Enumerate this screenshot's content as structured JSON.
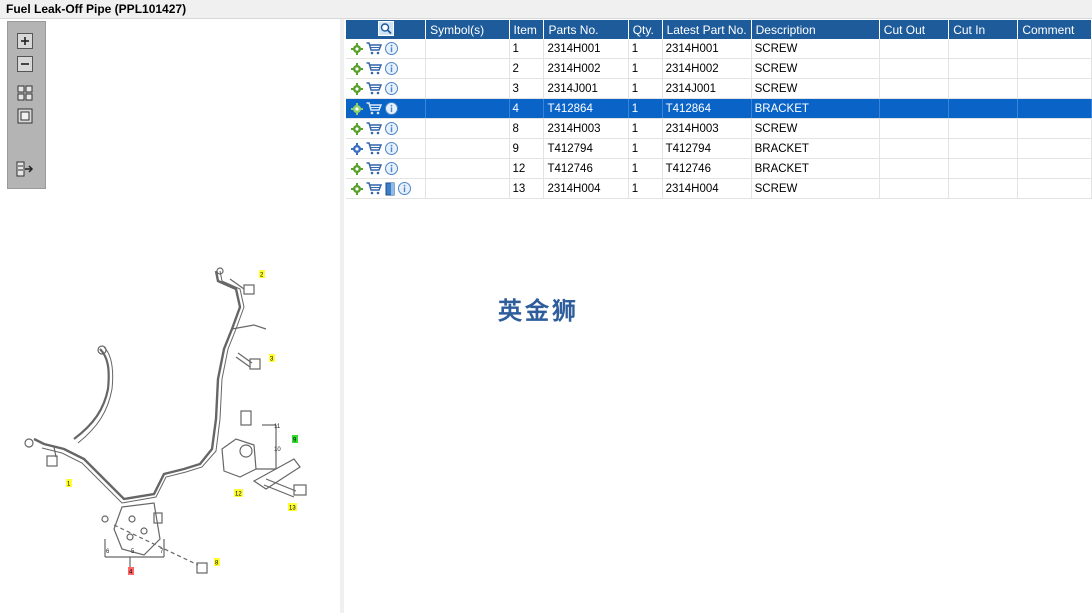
{
  "window": {
    "title": "Fuel Leak-Off Pipe (PPL101427)"
  },
  "toolbar": {
    "zoom_in": "zoom-in-icon",
    "zoom_out": "zoom-out-icon",
    "fit": "fit-page-icon",
    "actual": "actual-size-icon",
    "export": "export-list-icon"
  },
  "table": {
    "columns": [
      "",
      "Symbol(s)",
      "Item",
      "Parts No.",
      "Qty.",
      "Latest Part No.",
      "Description",
      "Cut Out",
      "Cut In",
      "Comment"
    ],
    "rows": [
      {
        "item": "1",
        "part": "2314H001",
        "qty": "1",
        "latest": "2314H001",
        "desc": "SCREW",
        "selected": false,
        "extra": false
      },
      {
        "item": "2",
        "part": "2314H002",
        "qty": "1",
        "latest": "2314H002",
        "desc": "SCREW",
        "selected": false,
        "extra": false
      },
      {
        "item": "3",
        "part": "2314J001",
        "qty": "1",
        "latest": "2314J001",
        "desc": "SCREW",
        "selected": false,
        "extra": false
      },
      {
        "item": "4",
        "part": "T412864",
        "qty": "1",
        "latest": "T412864",
        "desc": "BRACKET",
        "selected": true,
        "extra": false
      },
      {
        "item": "8",
        "part": "2314H003",
        "qty": "1",
        "latest": "2314H003",
        "desc": "SCREW",
        "selected": false,
        "extra": false
      },
      {
        "item": "9",
        "part": "T412794",
        "qty": "1",
        "latest": "T412794",
        "desc": "BRACKET",
        "selected": false,
        "extra": false
      },
      {
        "item": "12",
        "part": "T412746",
        "qty": "1",
        "latest": "T412746",
        "desc": "BRACKET",
        "selected": false,
        "extra": false
      },
      {
        "item": "13",
        "part": "2314H004",
        "qty": "1",
        "latest": "2314H004",
        "desc": "SCREW",
        "selected": false,
        "extra": true
      }
    ]
  },
  "diagram": {
    "callouts": [
      {
        "label": "2",
        "color": "#ffff33"
      },
      {
        "label": "3",
        "color": "#ffff33"
      },
      {
        "label": "1",
        "color": "#ffff33"
      },
      {
        "label": "9",
        "color": "#33dd33"
      },
      {
        "label": "12",
        "color": "#ffff33"
      },
      {
        "label": "13",
        "color": "#ffff33"
      },
      {
        "label": "8",
        "color": "#ffff33"
      },
      {
        "label": "4",
        "color": "#ff6666"
      }
    ],
    "sublabels": [
      "11",
      "10",
      "6",
      "5",
      "7"
    ]
  },
  "watermark": {
    "text": "英金狮"
  },
  "colors": {
    "header": "#1e5b9b",
    "selected_row": "#0a64c8",
    "gear": "#5aa02c",
    "cart": "#3366aa",
    "info": "#4a86c8"
  }
}
